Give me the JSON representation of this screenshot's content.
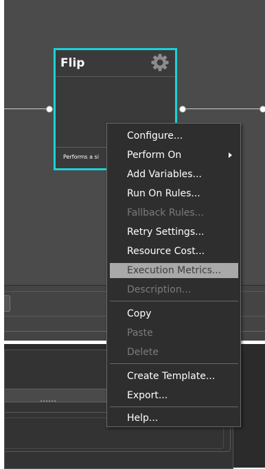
{
  "colors": {
    "canvas": "#4b4b4b",
    "node_border": "#19d3d9",
    "node_body": "#3a3a3a",
    "menu_bg": "#2e2e2e",
    "menu_highlight": "#a9a9a9",
    "disabled_text": "#7c7c7c"
  },
  "node": {
    "title": "Flip",
    "settings_icon": "gear-icon",
    "description": "Performs a si"
  },
  "context_menu": {
    "items": [
      {
        "label": "Configure...",
        "enabled": true
      },
      {
        "label": "Perform On",
        "enabled": true,
        "submenu": true
      },
      {
        "label": "Add Variables...",
        "enabled": true
      },
      {
        "label": "Run On Rules...",
        "enabled": true
      },
      {
        "label": "Fallback Rules...",
        "enabled": false
      },
      {
        "label": "Retry Settings...",
        "enabled": true
      },
      {
        "label": "Resource Cost...",
        "enabled": true
      },
      {
        "label": "Execution Metrics...",
        "enabled": true,
        "highlighted": true
      },
      {
        "label": "Description...",
        "enabled": false
      },
      {
        "label": "Copy",
        "enabled": true
      },
      {
        "label": "Paste",
        "enabled": false
      },
      {
        "label": "Delete",
        "enabled": false
      },
      {
        "label": "Create Template...",
        "enabled": true
      },
      {
        "label": "Export...",
        "enabled": true
      },
      {
        "label": "Help...",
        "enabled": true
      }
    ]
  }
}
